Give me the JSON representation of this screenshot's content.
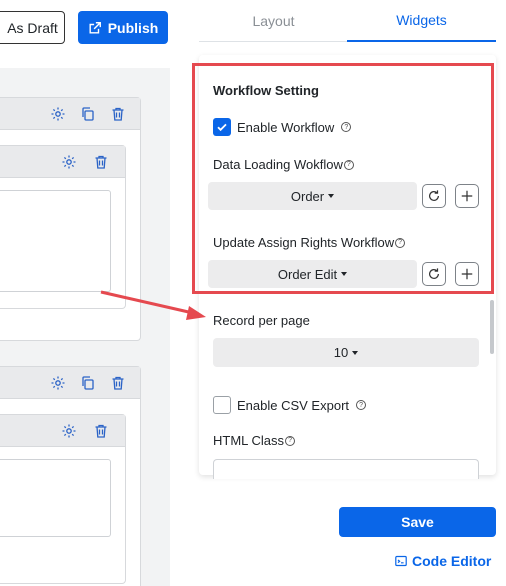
{
  "toolbar": {
    "draft_label": "As Draft",
    "publish_label": "Publish"
  },
  "tabs": {
    "layout": "Layout",
    "widgets": "Widgets",
    "active": "Widgets"
  },
  "workflow": {
    "title": "Workflow Setting",
    "enable_label": "Enable Workflow",
    "enable_checked": true,
    "data_loading_label": "Data Loading Wokflow",
    "data_loading_value": "Order",
    "update_rights_label": "Update Assign Rights Workflow",
    "update_rights_value": "Order Edit"
  },
  "record": {
    "label": "Record per page",
    "value": "10"
  },
  "csv": {
    "label": "Enable CSV Export",
    "checked": false
  },
  "html_class": {
    "label": "HTML Class",
    "value": ""
  },
  "actions": {
    "save_label": "Save",
    "code_editor_label": "Code Editor"
  },
  "colors": {
    "accent": "#0a66e8",
    "highlight": "#e5494f"
  },
  "icons": {
    "help": "?"
  }
}
